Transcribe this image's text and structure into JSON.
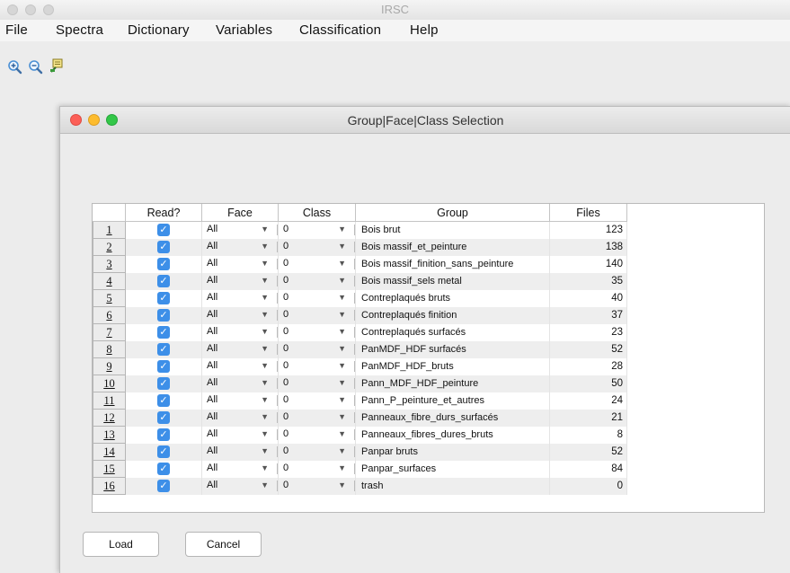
{
  "window": {
    "title": "IRSC"
  },
  "menu": [
    "File",
    "Spectra",
    "Dictionary",
    "Variables",
    "Classification",
    "Help"
  ],
  "toolbar": {
    "icons": [
      "zoom-in-icon",
      "zoom-out-icon",
      "pin-icon"
    ]
  },
  "dialog": {
    "title": "Group|Face|Class Selection",
    "columns": [
      "",
      "Read?",
      "Face",
      "Class",
      "Group",
      "Files"
    ],
    "rows": [
      {
        "n": "1",
        "read": true,
        "face": "All",
        "cls": "0",
        "group": "Bois brut",
        "files": "123"
      },
      {
        "n": "2",
        "read": true,
        "face": "All",
        "cls": "0",
        "group": "Bois massif_et_peinture",
        "files": "138"
      },
      {
        "n": "3",
        "read": true,
        "face": "All",
        "cls": "0",
        "group": "Bois massif_finition_sans_peinture",
        "files": "140"
      },
      {
        "n": "4",
        "read": true,
        "face": "All",
        "cls": "0",
        "group": "Bois massif_sels metal",
        "files": "35"
      },
      {
        "n": "5",
        "read": true,
        "face": "All",
        "cls": "0",
        "group": "Contreplaqués bruts",
        "files": "40"
      },
      {
        "n": "6",
        "read": true,
        "face": "All",
        "cls": "0",
        "group": "Contreplaqués finition",
        "files": "37"
      },
      {
        "n": "7",
        "read": true,
        "face": "All",
        "cls": "0",
        "group": "Contreplaqués surfacés",
        "files": "23"
      },
      {
        "n": "8",
        "read": true,
        "face": "All",
        "cls": "0",
        "group": "PanMDF_HDF surfacés",
        "files": "52"
      },
      {
        "n": "9",
        "read": true,
        "face": "All",
        "cls": "0",
        "group": "PanMDF_HDF_bruts",
        "files": "28"
      },
      {
        "n": "10",
        "read": true,
        "face": "All",
        "cls": "0",
        "group": "Pann_MDF_HDF_peinture",
        "files": "50"
      },
      {
        "n": "11",
        "read": true,
        "face": "All",
        "cls": "0",
        "group": "Pann_P_peinture_et_autres",
        "files": "24"
      },
      {
        "n": "12",
        "read": true,
        "face": "All",
        "cls": "0",
        "group": "Panneaux_fibre_durs_surfacés",
        "files": "21"
      },
      {
        "n": "13",
        "read": true,
        "face": "All",
        "cls": "0",
        "group": "Panneaux_fibres_dures_bruts",
        "files": "8"
      },
      {
        "n": "14",
        "read": true,
        "face": "All",
        "cls": "0",
        "group": "Panpar bruts",
        "files": "52"
      },
      {
        "n": "15",
        "read": true,
        "face": "All",
        "cls": "0",
        "group": "Panpar_surfaces",
        "files": "84"
      },
      {
        "n": "16",
        "read": true,
        "face": "All",
        "cls": "0",
        "group": "trash",
        "files": "0"
      }
    ],
    "load_label": "Load",
    "cancel_label": "Cancel"
  },
  "colors": {
    "checkbox": "#3d8fe8",
    "close": "#fc5f57",
    "minimize": "#fdbc2e",
    "zoom": "#33c748"
  }
}
